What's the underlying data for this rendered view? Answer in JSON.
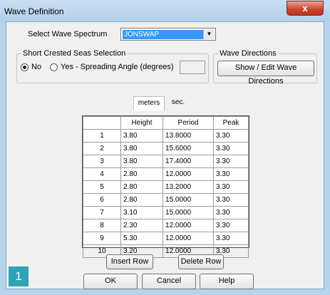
{
  "window": {
    "title": "Wave Definition",
    "close_label": "x"
  },
  "spectrum": {
    "label": "Select Wave Spectrum",
    "value": "JONSWAP"
  },
  "short_crested": {
    "caption": "Short Crested Seas Selection",
    "option_no": "No",
    "option_yes": "Yes - Spreading Angle (degrees)",
    "angle_value": ""
  },
  "wave_directions": {
    "caption": "Wave Directions",
    "button": "Show / Edit Wave Directions"
  },
  "units_tabs": [
    "meters",
    "sec."
  ],
  "table": {
    "headers": [
      "",
      "Height",
      "Period",
      "Peak"
    ],
    "rows": [
      [
        "1",
        "3.80",
        "13.8000",
        "3.30"
      ],
      [
        "2",
        "3.80",
        "15.6000",
        "3.30"
      ],
      [
        "3",
        "3.80",
        "17.4000",
        "3.30"
      ],
      [
        "4",
        "2.80",
        "12.0000",
        "3.30"
      ],
      [
        "5",
        "2.80",
        "13.2000",
        "3.30"
      ],
      [
        "6",
        "2.80",
        "15.0000",
        "3.30"
      ],
      [
        "7",
        "3.10",
        "15.0000",
        "3.30"
      ],
      [
        "8",
        "2.30",
        "12.0000",
        "3.30"
      ],
      [
        "9",
        "5.30",
        "12.0000",
        "3.30"
      ],
      [
        "10",
        "3.20",
        "12.0000",
        "3.30"
      ]
    ]
  },
  "buttons": {
    "insert_row": "Insert Row",
    "delete_row": "Delete Row",
    "ok": "OK",
    "cancel": "Cancel",
    "help": "Help"
  },
  "badge": "1"
}
